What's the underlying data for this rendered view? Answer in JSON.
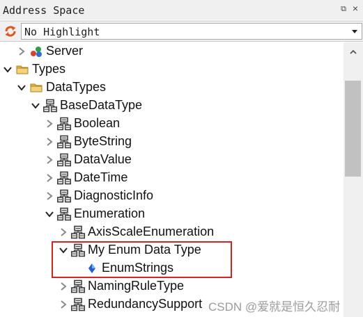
{
  "window": {
    "title": "Address Space",
    "pin_glyph": "⧉",
    "close_glyph": "×"
  },
  "toolbar": {
    "highlight_select": {
      "value": "No Highlight"
    }
  },
  "tree": {
    "rows": [
      {
        "label": "Server",
        "level": 1,
        "expander": "collapsed",
        "icon": "server-icon"
      },
      {
        "label": "Types",
        "level": 0,
        "expander": "expanded",
        "icon": "folder-icon"
      },
      {
        "label": "DataTypes",
        "level": 1,
        "expander": "expanded",
        "icon": "folder-icon"
      },
      {
        "label": "BaseDataType",
        "level": 2,
        "expander": "expanded",
        "icon": "datatype-icon"
      },
      {
        "label": "Boolean",
        "level": 3,
        "expander": "collapsed",
        "icon": "datatype-icon"
      },
      {
        "label": "ByteString",
        "level": 3,
        "expander": "collapsed",
        "icon": "datatype-icon"
      },
      {
        "label": "DataValue",
        "level": 3,
        "expander": "collapsed",
        "icon": "datatype-icon"
      },
      {
        "label": "DateTime",
        "level": 3,
        "expander": "collapsed",
        "icon": "datatype-icon"
      },
      {
        "label": "DiagnosticInfo",
        "level": 3,
        "expander": "collapsed",
        "icon": "datatype-icon"
      },
      {
        "label": "Enumeration",
        "level": 3,
        "expander": "expanded",
        "icon": "datatype-icon"
      },
      {
        "label": "AxisScaleEnumeration",
        "level": 4,
        "expander": "collapsed",
        "icon": "datatype-icon"
      },
      {
        "label": "My Enum Data Type",
        "level": 4,
        "expander": "expanded",
        "icon": "datatype-icon",
        "highlighted": true
      },
      {
        "label": "EnumStrings",
        "level": 5,
        "expander": "none",
        "icon": "property-icon",
        "highlighted": true
      },
      {
        "label": "NamingRuleType",
        "level": 4,
        "expander": "collapsed",
        "icon": "datatype-icon"
      },
      {
        "label": "RedundancySupport",
        "level": 4,
        "expander": "collapsed",
        "icon": "datatype-icon"
      }
    ]
  },
  "watermark": "CSDN @爱就是恒久忍耐",
  "colors": {
    "highlight_border": "#d42323",
    "folder": "#e8b84a",
    "icon_gray": "#3c3c3c",
    "property_blue": "#1f5fcf",
    "refresh_orange": "#e0561b"
  }
}
